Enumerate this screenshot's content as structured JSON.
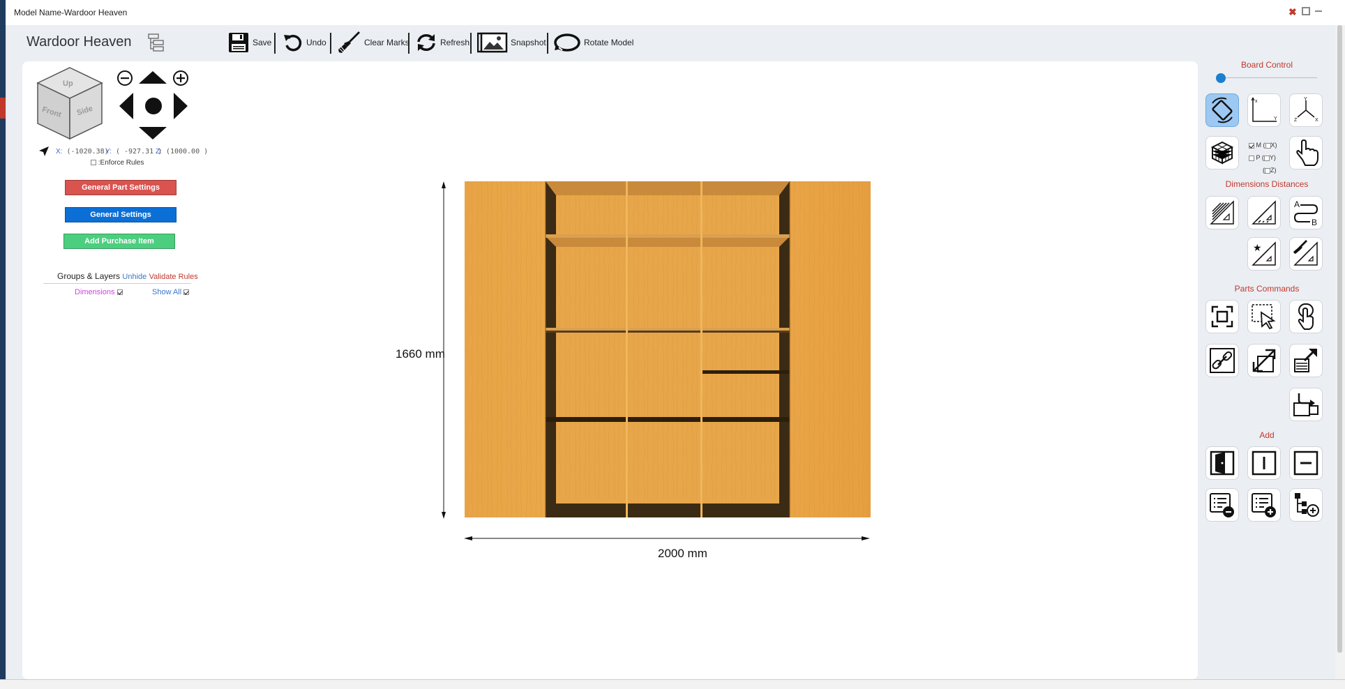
{
  "window": {
    "title": "Model Name-Wardoor Heaven"
  },
  "app": {
    "title": "Wardoor Heaven"
  },
  "toolbar": {
    "save": "Save",
    "undo": "Undo",
    "clear_marks": "Clear Marks",
    "refresh": "Refresh",
    "snapshot": "Snapshot",
    "rotate_model": "Rotate Model"
  },
  "view_cube": {
    "up": "Up",
    "front": "Front",
    "side": "Side"
  },
  "coords": {
    "x_label": "X:",
    "x_value": "(-1020.38)",
    "y_label": "Y:",
    "y_value": "( -927.31 )",
    "z_label": "Z:",
    "z_value": "(1000.00 )"
  },
  "enforce_rules": {
    "label": ":Enforce Rules",
    "checked": false
  },
  "buttons": {
    "general_part_settings": "General Part Settings",
    "general_settings": "General Settings",
    "add_purchase_item": "Add Purchase Item"
  },
  "groups": {
    "title": "Groups & Layers",
    "unhide": "Unhide",
    "validate_rules": "Validate Rules",
    "dimensions_label": "Dimensions",
    "dimensions_checked": true,
    "show_all_label": "Show All",
    "show_all_checked": true
  },
  "model": {
    "height_label": "1660 mm",
    "width_label": "2000 mm",
    "wood_color": "#e9a445"
  },
  "right_panel": {
    "board_control": "Board Control",
    "dimensions_distances": "Dimensions Distances",
    "parts_commands": "Parts Commands",
    "add": "Add",
    "slider_value": 0,
    "m_label": "M (",
    "m_checked": true,
    "x_label": "X)",
    "p_label": "P (",
    "y_label": "Y)",
    "z_open": "(",
    "z_label": "Z)"
  },
  "colors": {
    "red": "#d9534f",
    "blue": "#0b6fd6",
    "green": "#4cce7f",
    "accent_red": "#c0392b"
  }
}
